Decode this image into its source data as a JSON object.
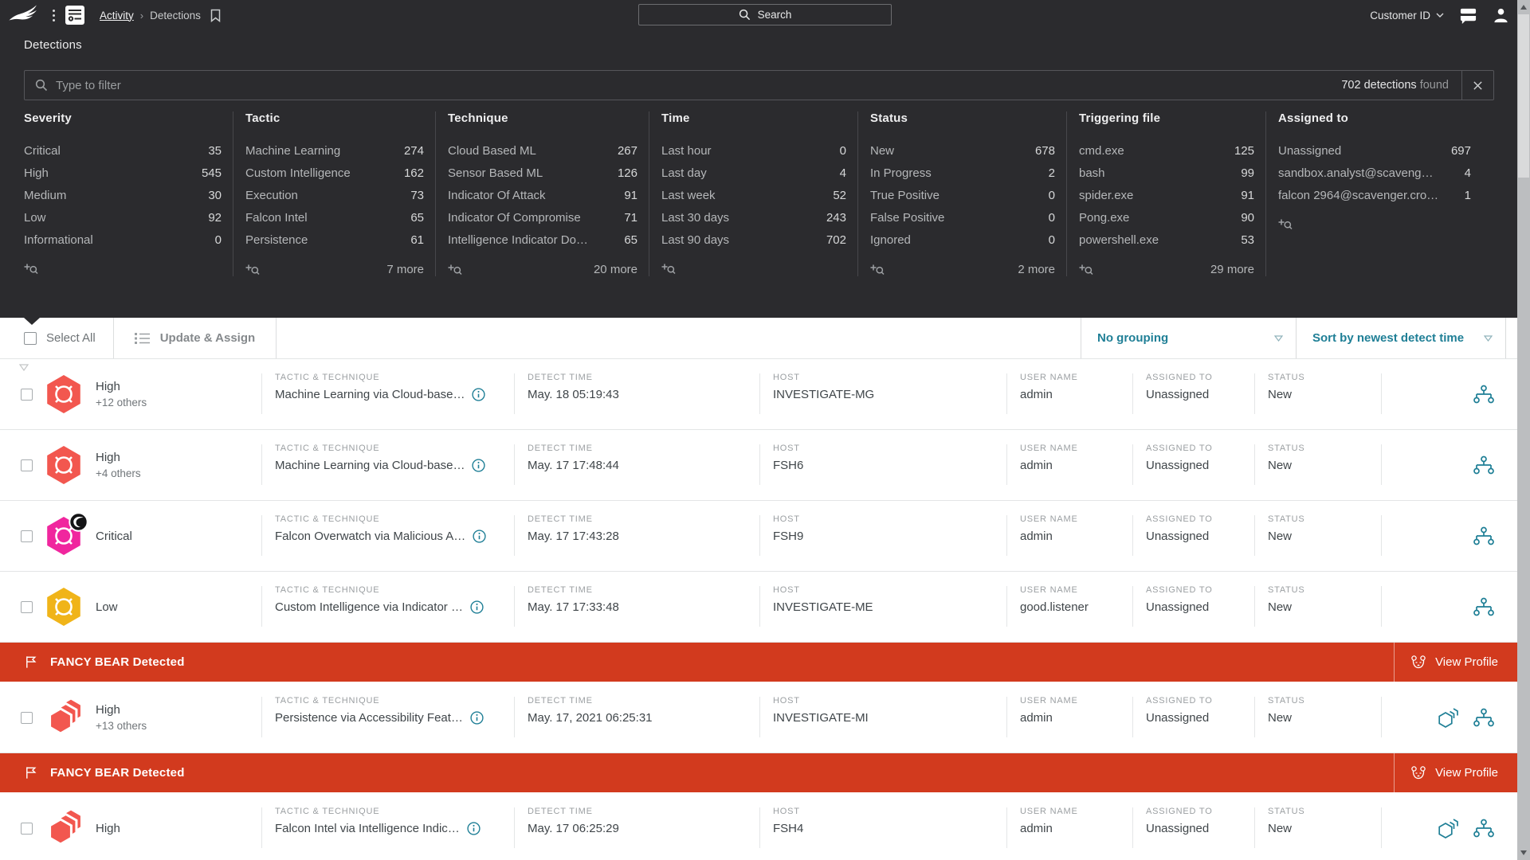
{
  "colors": {
    "accent_teal": "#1f7f96",
    "banner_red": "#d23a1e",
    "dark_bg": "#2b2b2e"
  },
  "topbar": {
    "breadcrumb_parent": "Activity",
    "breadcrumb_current": "Detections",
    "search_placeholder": "Search",
    "customer_id_label": "Customer ID"
  },
  "page_title": "Detections",
  "filter_bar": {
    "placeholder": "Type to filter",
    "result_count": "702 detections",
    "result_suffix": " found"
  },
  "facet_columns": [
    {
      "title": "Severity",
      "items": [
        {
          "label": "Critical",
          "count": "35"
        },
        {
          "label": "High",
          "count": "545"
        },
        {
          "label": "Medium",
          "count": "30"
        },
        {
          "label": "Low",
          "count": "92"
        },
        {
          "label": "Informational",
          "count": "0"
        }
      ],
      "more": ""
    },
    {
      "title": "Tactic",
      "items": [
        {
          "label": "Machine Learning",
          "count": "274"
        },
        {
          "label": "Custom Intelligence",
          "count": "162"
        },
        {
          "label": "Execution",
          "count": "73"
        },
        {
          "label": "Falcon Intel",
          "count": "65"
        },
        {
          "label": "Persistence",
          "count": "61"
        }
      ],
      "more": "7 more"
    },
    {
      "title": "Technique",
      "items": [
        {
          "label": "Cloud Based ML",
          "count": "267"
        },
        {
          "label": "Sensor Based ML",
          "count": "126"
        },
        {
          "label": "Indicator Of Attack",
          "count": "91"
        },
        {
          "label": "Indicator Of Compromise",
          "count": "71"
        },
        {
          "label": "Intelligence Indicator Do…",
          "count": "65"
        }
      ],
      "more": "20 more"
    },
    {
      "title": "Time",
      "items": [
        {
          "label": "Last hour",
          "count": "0"
        },
        {
          "label": "Last day",
          "count": "4"
        },
        {
          "label": "Last week",
          "count": "52"
        },
        {
          "label": "Last 30 days",
          "count": "243"
        },
        {
          "label": "Last 90 days",
          "count": "702"
        }
      ],
      "more": ""
    },
    {
      "title": "Status",
      "items": [
        {
          "label": "New",
          "count": "678"
        },
        {
          "label": "In Progress",
          "count": "2"
        },
        {
          "label": "True Positive",
          "count": "0"
        },
        {
          "label": "False Positive",
          "count": "0"
        },
        {
          "label": "Ignored",
          "count": "0"
        }
      ],
      "more": "2 more"
    },
    {
      "title": "Triggering file",
      "items": [
        {
          "label": "cmd.exe",
          "count": "125"
        },
        {
          "label": "bash",
          "count": "99"
        },
        {
          "label": "spider.exe",
          "count": "91"
        },
        {
          "label": "Pong.exe",
          "count": "90"
        },
        {
          "label": "powershell.exe",
          "count": "53"
        }
      ],
      "more": "29 more"
    },
    {
      "title": "Assigned to",
      "items": [
        {
          "label": "Unassigned",
          "count": "697"
        },
        {
          "label": "sandbox.analyst@scaveng…",
          "count": "4"
        },
        {
          "label": "falcon 2964@scavenger.cro…",
          "count": "1"
        }
      ],
      "more": ""
    }
  ],
  "toolbar": {
    "select_all_label": "Select All",
    "update_assign_label": "Update & Assign",
    "grouping_label": "No grouping",
    "sort_label": "Sort by newest detect time"
  },
  "row_headers": {
    "tactic": "TACTIC & TECHNIQUE",
    "time": "DETECT TIME",
    "host": "HOST",
    "user": "USER NAME",
    "assigned": "ASSIGNED TO",
    "status": "STATUS"
  },
  "banner": {
    "title": "FANCY BEAR Detected",
    "action_label": "View Profile"
  },
  "detection_list": [
    {
      "type": "row",
      "severity": "High",
      "severity_extra": "+12 others",
      "severity_color": "#f2574f",
      "icon": "hex-target",
      "badge": false,
      "tactic": "Machine Learning via Cloud-base…",
      "time": "May. 18 05:19:43",
      "host": "INVESTIGATE-MG",
      "user": "admin",
      "assigned": "Unassigned",
      "status": "New",
      "actions": [
        "tree"
      ]
    },
    {
      "type": "row",
      "severity": "High",
      "severity_extra": "+4 others",
      "severity_color": "#f2574f",
      "icon": "hex-target",
      "badge": false,
      "tactic": "Machine Learning via Cloud-base…",
      "time": "May. 17 17:48:44",
      "host": "FSH6",
      "user": "admin",
      "assigned": "Unassigned",
      "status": "New",
      "actions": [
        "tree"
      ]
    },
    {
      "type": "row",
      "severity": "Critical",
      "severity_extra": "",
      "severity_color": "#f0269e",
      "icon": "hex-target",
      "badge": true,
      "tactic": "Falcon Overwatch via Malicious A…",
      "time": "May. 17 17:43:28",
      "host": "FSH9",
      "user": "admin",
      "assigned": "Unassigned",
      "status": "New",
      "actions": [
        "tree"
      ]
    },
    {
      "type": "row",
      "severity": "Low",
      "severity_extra": "",
      "severity_color": "#f0b419",
      "icon": "hex-target",
      "badge": false,
      "tactic": "Custom Intelligence via Indicator …",
      "time": "May. 17 17:33:48",
      "host": "INVESTIGATE-ME",
      "user": "good.listener",
      "assigned": "Unassigned",
      "status": "New",
      "actions": [
        "tree"
      ]
    },
    {
      "type": "banner"
    },
    {
      "type": "row",
      "severity": "High",
      "severity_extra": "+13 others",
      "severity_color": "#f2574f",
      "icon": "hex-layers",
      "badge": false,
      "tactic": "Persistence via Accessibility Feat…",
      "time": "May. 17, 2021 06:25:31",
      "host": "INVESTIGATE-MI",
      "user": "admin",
      "assigned": "Unassigned",
      "status": "New",
      "actions": [
        "stack",
        "tree"
      ]
    },
    {
      "type": "banner"
    },
    {
      "type": "row",
      "severity": "High",
      "severity_extra": "",
      "severity_color": "#f2574f",
      "icon": "hex-layers",
      "badge": false,
      "tactic": "Falcon Intel via Intelligence Indic…",
      "time": "May. 17 06:25:29",
      "host": "FSH4",
      "user": "admin",
      "assigned": "Unassigned",
      "status": "New",
      "actions": [
        "stack",
        "tree"
      ]
    }
  ]
}
